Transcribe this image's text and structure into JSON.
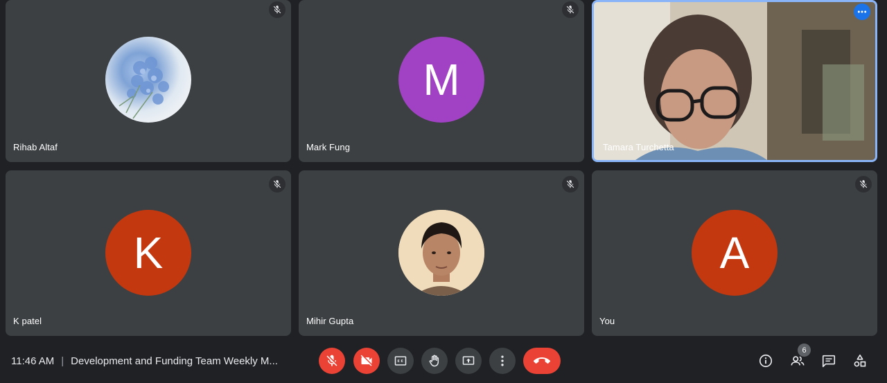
{
  "participants": [
    {
      "name": "Rihab Altaf",
      "avatar_type": "flower-photo",
      "muted": true
    },
    {
      "name": "Mark Fung",
      "avatar_letter": "M",
      "avatar_color": "#a142c4",
      "muted": true
    },
    {
      "name": "Tamara Turchetta",
      "avatar_type": "live-video",
      "active_speaker": true
    },
    {
      "name": "K patel",
      "avatar_letter": "K",
      "avatar_color": "#c3380f",
      "muted": true
    },
    {
      "name": "Mihir Gupta",
      "avatar_type": "profile-photo",
      "muted": true
    },
    {
      "name": "You",
      "avatar_letter": "A",
      "avatar_color": "#c3380f",
      "muted": true
    }
  ],
  "meeting": {
    "time": "11:46 AM",
    "separator": "|",
    "title": "Development and Funding Team Weekly M..."
  },
  "controls": {
    "mic_icon": "mic-off-icon",
    "camera_icon": "videocam-off-icon",
    "captions_icon": "closed-caption-icon",
    "hand_icon": "raise-hand-icon",
    "present_icon": "present-screen-icon",
    "more_icon": "more-vert-icon",
    "end_icon": "call-end-icon"
  },
  "right_panel": {
    "people_count": "6",
    "icons": [
      "info-icon",
      "people-icon",
      "chat-icon",
      "activities-icon"
    ]
  },
  "colors": {
    "tile_bg": "#3c4043",
    "page_bg": "#202124",
    "danger": "#ea4335",
    "accent": "#1a73e8",
    "speaker_border": "#8ab4f8"
  }
}
